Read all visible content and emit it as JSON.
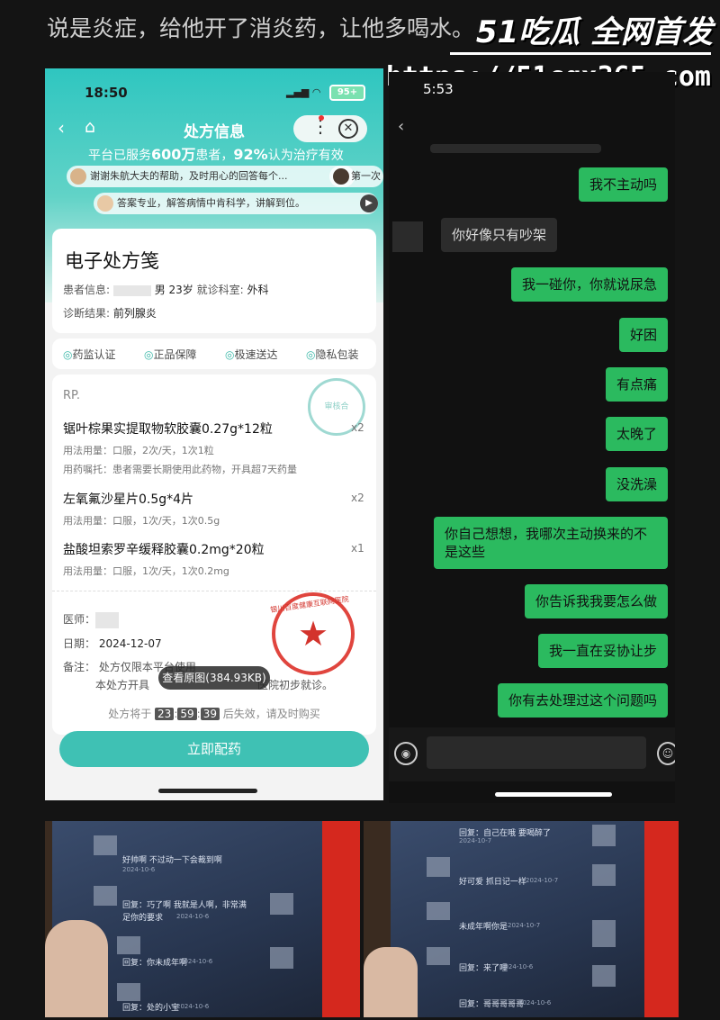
{
  "caption": "说是炎症，给他开了消炎药，让他多喝水。",
  "watermark": {
    "brand": "51吃瓜 全网首发",
    "url": "https://51cgx365.com"
  },
  "left_phone": {
    "status_time": "18:50",
    "battery": "95+",
    "nav_title": "处方信息",
    "stats_prefix": "平台已服务",
    "stats_count": "600万",
    "stats_mid": "患者，",
    "stats_pct": "92%",
    "stats_suffix": "认为治疗有效",
    "reviews": [
      "谢谢朱航大夫的帮助，及时用心的回答每个...",
      "第一次",
      "答案专业，解答病情中肯科学，讲解到位。"
    ],
    "rx_title": "电子处方笺",
    "patient_label": "患者信息:",
    "patient_value": "男 23岁",
    "dept_label": "就诊科室:",
    "dept_value": "外科",
    "diag_label": "诊断结果:",
    "diag_value": "前列腺炎",
    "badges": [
      "药监认证",
      "正品保障",
      "极速送达",
      "隐私包装"
    ],
    "rp": "RP.",
    "stamp_small": "审核合",
    "drugs": [
      {
        "name": "锯叶棕果实提取物软胶囊0.27g*12粒",
        "qty": "x2",
        "usage": "用法用量：口服，2次/天，1次1粒",
        "note": "用药嘱托：患者需要长期使用此药物，开具超7天药量"
      },
      {
        "name": "左氧氟沙星片0.5g*4片",
        "qty": "x2",
        "usage": "用法用量：口服，1次/天，1次0.5g",
        "note": ""
      },
      {
        "name": "盐酸坦索罗辛缓释胶囊0.2mg*20粒",
        "qty": "x1",
        "usage": "用法用量：口服，1次/天，1次0.2mg",
        "note": ""
      }
    ],
    "doctor_label": "医师：",
    "date_label": "日期：",
    "date_value": "2024-12-07",
    "remark_label": "备注：",
    "remark_line1": "处方仅限本平台使用",
    "remark_line2": "本处方开具",
    "remark_line2b": "医院初步就诊。",
    "stamp_text": "银川百度健康互联网医院",
    "tooltip": "查看原图(384.93KB)",
    "timer_prefix": "处方将于",
    "timer_h": "23",
    "timer_m": "59",
    "timer_s": "39",
    "timer_suffix": "后失效，请及时购买",
    "button": "立即配药"
  },
  "right_phone": {
    "status_time": "5:53",
    "messages": [
      {
        "side": "right",
        "text": "我不主动吗"
      },
      {
        "side": "left",
        "text": "你好像只有吵架"
      },
      {
        "side": "right",
        "text": "我一碰你，你就说尿急"
      },
      {
        "side": "right",
        "text": "好困"
      },
      {
        "side": "right",
        "text": "有点痛"
      },
      {
        "side": "right",
        "text": "太晚了"
      },
      {
        "side": "right",
        "text": "没洗澡"
      },
      {
        "side": "right",
        "text": "你自己想想，我哪次主动换来的不"
      },
      {
        "side": "right",
        "text": "是这些"
      },
      {
        "side": "right",
        "text": "你告诉我我要怎么做"
      },
      {
        "side": "right",
        "text": "我一直在妥协让步"
      },
      {
        "side": "right",
        "text": "你有去处理过这个问题吗"
      }
    ]
  },
  "photo_left": {
    "comments": [
      {
        "text": "好帅啊 不过动一下会裁到啊",
        "date": "2024-10-6"
      },
      {
        "text": "回复：巧了啊 我就是人啊，非常满",
        "date": ""
      },
      {
        "text": "足你的要求",
        "date": "2024-10-6"
      },
      {
        "text": "回复：你未成年啊",
        "date": "2024-10-6"
      },
      {
        "text": "回复：处的小宝",
        "date": "2024-10-6"
      }
    ]
  },
  "photo_right": {
    "comments": [
      {
        "text": "回复：自己在哦 要喝醉了",
        "date": "2024-10-7"
      },
      {
        "text": "好可爱 抓日记一样",
        "date": "2024-10-7"
      },
      {
        "text": "未成年啊你是",
        "date": "2024-10-7"
      },
      {
        "text": "回复：来了哩",
        "date": "2024-10-6"
      },
      {
        "text": "回复：哥哥哥哥哥",
        "date": "2024-10-6"
      }
    ]
  }
}
